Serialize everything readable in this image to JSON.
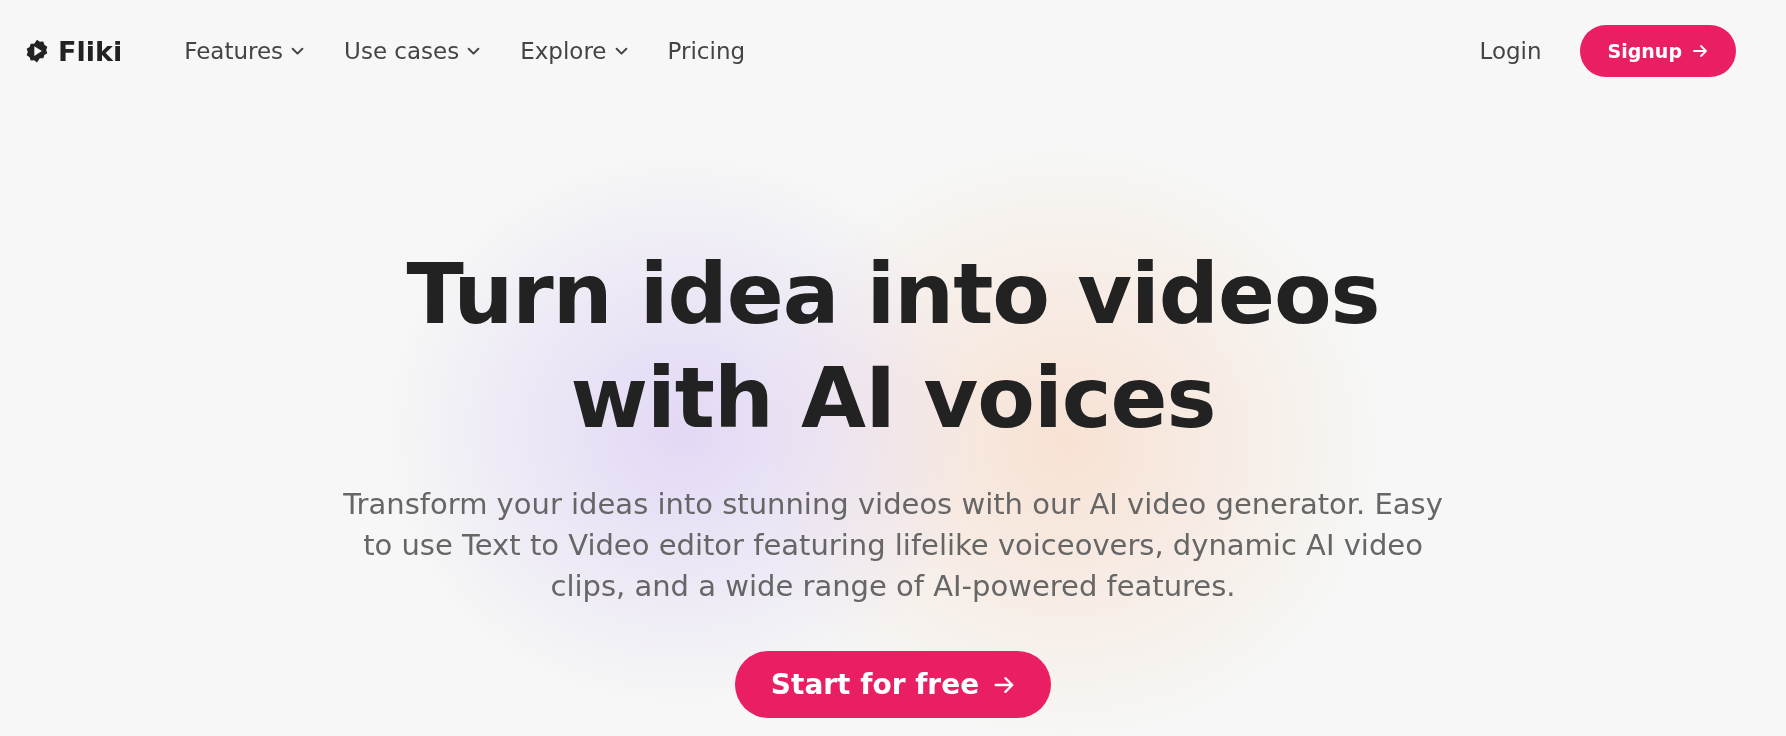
{
  "header": {
    "logo": "Fliki",
    "nav": [
      {
        "label": "Features",
        "dropdown": true
      },
      {
        "label": "Use cases",
        "dropdown": true
      },
      {
        "label": "Explore",
        "dropdown": true
      },
      {
        "label": "Pricing",
        "dropdown": false
      }
    ],
    "login": "Login",
    "signup": "Signup"
  },
  "hero": {
    "title": "Turn idea into videos with AI voices",
    "subtitle": "Transform your ideas into stunning videos with our AI video generator. Easy to use Text to Video editor featuring lifelike voiceovers, dynamic AI video clips, and a wide range of AI-powered features.",
    "cta": "Start for free"
  }
}
